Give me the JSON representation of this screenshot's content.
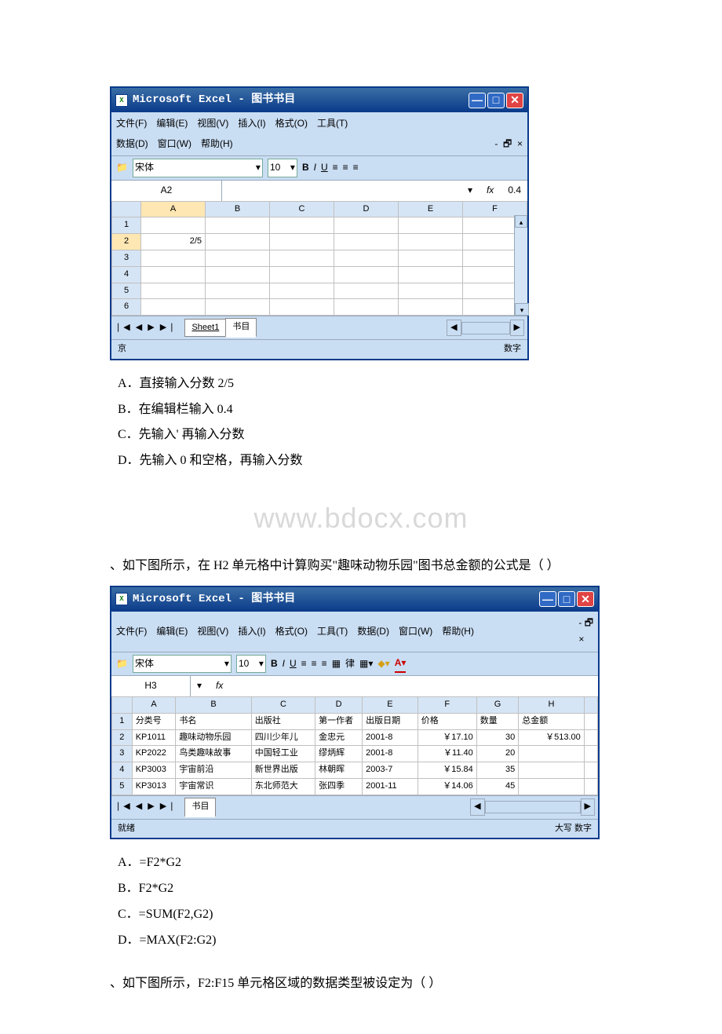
{
  "win1": {
    "title": "Microsoft Excel - 图书书目",
    "menus_line1": [
      "文件(F)",
      "编辑(E)",
      "视图(V)",
      "插入(I)",
      "格式(O)",
      "工具(T)"
    ],
    "menus_line2": [
      "数据(D)",
      "窗口(W)",
      "帮助(H)"
    ],
    "font": "宋体",
    "fontsize": "10",
    "namebox": "A2",
    "fx": "fx",
    "formula": "0.4",
    "col_headers": [
      "A",
      "B",
      "C",
      "D",
      "E",
      "F"
    ],
    "row_headers": [
      "1",
      "2",
      "3",
      "4",
      "5",
      "6"
    ],
    "activecell_value": "2/5",
    "tab_nav": "❘◀ ◀ ▶ ▶❘",
    "tabs": [
      "Sheet1",
      "书目"
    ],
    "status_left": "京",
    "status_right": "数字"
  },
  "answers1": {
    "A": "A．直接输入分数 2/5",
    "B": "B．在编辑栏输入 0.4",
    "C": "C．先输入' 再输入分数",
    "D": "D．先输入 0 和空格，再输入分数"
  },
  "watermark": "www.bdocx.com",
  "question2": "、如下图所示，在 H2 单元格中计算购买\"趣味动物乐园\"图书总金额的公式是（ ）",
  "win2": {
    "title": "Microsoft Excel - 图书书目",
    "menus": [
      "文件(F)",
      "编辑(E)",
      "视图(V)",
      "插入(I)",
      "格式(O)",
      "工具(T)",
      "数据(D)",
      "窗口(W)",
      "帮助(H)"
    ],
    "font": "宋体",
    "fontsize": "10",
    "namebox": "H3",
    "fx": "fx",
    "col_headers": [
      "A",
      "B",
      "C",
      "D",
      "E",
      "F",
      "G",
      "H"
    ],
    "rows": [
      {
        "n": "1",
        "A": "分类号",
        "B": "书名",
        "C": "出版社",
        "D": "第一作者",
        "E": "出版日期",
        "F": "价格",
        "G": "数量",
        "H": "总金额"
      },
      {
        "n": "2",
        "A": "KP1011",
        "B": "趣味动物乐园",
        "C": "四川少年儿",
        "D": "金忠元",
        "E": "2001-8",
        "F": "￥17.10",
        "G": "30",
        "H": "￥513.00"
      },
      {
        "n": "3",
        "A": "KP2022",
        "B": "鸟类趣味故事",
        "C": "中国轻工业",
        "D": "缪炳辉",
        "E": "2001-8",
        "F": "￥11.40",
        "G": "20",
        "H": ""
      },
      {
        "n": "4",
        "A": "KP3003",
        "B": "宇宙前沿",
        "C": "新世界出版",
        "D": "林朝晖",
        "E": "2003-7",
        "F": "￥15.84",
        "G": "35",
        "H": ""
      },
      {
        "n": "5",
        "A": "KP3013",
        "B": "宇宙常识",
        "C": "东北师范大",
        "D": "张四季",
        "E": "2001-11",
        "F": "￥14.06",
        "G": "45",
        "H": ""
      }
    ],
    "tab_nav": "❘◀ ◀ ▶ ▶❘",
    "tabs": [
      "书目"
    ],
    "status_left": "就绪",
    "status_right": "大写 数字"
  },
  "answers2": {
    "A": "A．=F2*G2",
    "B": "B．F2*G2",
    "C": "C．=SUM(F2,G2)",
    "D": "D．=MAX(F2:G2)"
  },
  "question3": "、如下图所示，F2:F15 单元格区域的数据类型被设定为（ ）"
}
